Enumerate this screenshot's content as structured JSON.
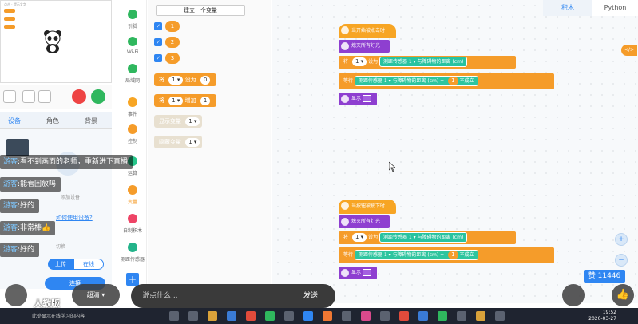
{
  "stage": {
    "title": "点击 · 提示文字"
  },
  "device_tabs": [
    "设备",
    "角色",
    "背景"
  ],
  "device_panel": {
    "add_label": "添加设备",
    "help_link": "如何使用设备?",
    "sub_label": "切换"
  },
  "buttons": {
    "upload": "上传",
    "online": "在线",
    "connect": "连接"
  },
  "categories": [
    {
      "label": "引脚",
      "color": "#2fb75e"
    },
    {
      "label": "Wi-Fi",
      "color": "#2fb75e"
    },
    {
      "label": "局域网",
      "color": "#2fb75e"
    },
    {
      "label": "事件",
      "color": "#f7a524"
    },
    {
      "label": "控制",
      "color": "#f59c2a"
    },
    {
      "label": "运算",
      "color": "#26c68a"
    },
    {
      "label": "变量",
      "color": "#f59c2a"
    },
    {
      "label": "自制积木",
      "color": "#ee4466"
    },
    {
      "label": "测距传感器",
      "color": "#23b38a"
    }
  ],
  "palette": {
    "new_variable": "建立一个变量",
    "vars": [
      "1",
      "2",
      "3"
    ],
    "blocks": [
      {
        "prefix": "将",
        "var": "1 ▾",
        "mid": "设为",
        "val": "0"
      },
      {
        "prefix": "将",
        "var": "1 ▾",
        "mid": "增加",
        "val": "1"
      },
      {
        "prefix": "显示变量",
        "var": "1 ▾",
        "mid": "",
        "val": ""
      },
      {
        "prefix": "隐藏变量",
        "var": "1 ▾",
        "mid": "",
        "val": ""
      }
    ]
  },
  "code_tabs": {
    "blocks": "积木",
    "python": "Python"
  },
  "script1": {
    "hat": "当开始被点击时",
    "b1": "熄灭所有灯光",
    "b2_a": "将",
    "b2_var": "1 ▾",
    "b2_b": "设为",
    "b2_sensor": "测距传感器  1 ▾  与障碍物的距离 (cm)",
    "b3_a": "等待",
    "b3_sensor": "测距传感器  1 ▾  与障碍物的距离 (cm)",
    "b3_op": "=",
    "b3_val": "1",
    "b3_tail": "不成立",
    "b4": "显示"
  },
  "script2": {
    "hat": "当按钮被按下时",
    "b1": "熄灭所有灯光",
    "b2_a": "将",
    "b2_var": "1 ▾",
    "b2_b": "设为",
    "b2_sensor": "测距传感器  1 ▾  与障碍物的距离 (cm)",
    "b3_a": "等待",
    "b3_sensor": "测距传感器  1 ▾  与障碍物的距离 (cm)",
    "b3_op": "=",
    "b3_val": "1",
    "b3_tail": "不成立",
    "b4": "显示"
  },
  "chat": [
    {
      "name": "游客",
      "text": ":看不到画面的老师，重新进下直播"
    },
    {
      "name": "游客",
      "text": ":能看回放吗"
    },
    {
      "name": "游客",
      "text": ":好的"
    },
    {
      "name": "游客",
      "text": ":非常棒👍"
    },
    {
      "name": "游客",
      "text": ":好的"
    }
  ],
  "bottom": {
    "logo": "人教版",
    "quality": "超清 ▾",
    "say_placeholder": "说点什么...",
    "send": "发送",
    "likes": "赞 11446"
  },
  "taskbar": {
    "caption": "此处显示在线学习的内容",
    "time": "19:52",
    "date": "2020-03-27"
  }
}
